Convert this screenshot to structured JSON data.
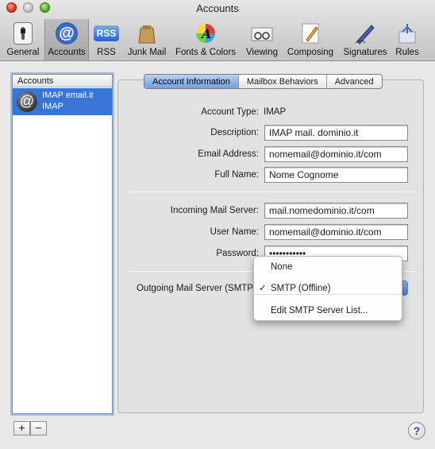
{
  "window": {
    "title": "Accounts"
  },
  "toolbar": [
    {
      "label": "General",
      "icon": "switch-icon"
    },
    {
      "label": "Accounts",
      "icon": "at-icon"
    },
    {
      "label": "RSS",
      "icon": "rss-icon"
    },
    {
      "label": "Junk Mail",
      "icon": "junk-bag-icon"
    },
    {
      "label": "Fonts & Colors",
      "icon": "font-color-icon"
    },
    {
      "label": "Viewing",
      "icon": "glasses-icon"
    },
    {
      "label": "Composing",
      "icon": "pencil-paper-icon"
    },
    {
      "label": "Signatures",
      "icon": "pen-icon"
    },
    {
      "label": "Rules",
      "icon": "rules-icon"
    }
  ],
  "sidebar": {
    "header": "Accounts",
    "items": [
      {
        "name": "IMAP email.it",
        "type": "IMAP"
      }
    ],
    "add_label": "+",
    "remove_label": "−"
  },
  "tabs": [
    "Account Information",
    "Mailbox Behaviors",
    "Advanced"
  ],
  "form": {
    "account_type_label": "Account Type:",
    "account_type_value": "IMAP",
    "description_label": "Description:",
    "description_value": "IMAP mail. dominio.it",
    "email_label": "Email Address:",
    "email_value": "nomemail@dominio.it/com",
    "fullname_label": "Full Name:",
    "fullname_value": "Nome Cognome",
    "incoming_label": "Incoming Mail Server:",
    "incoming_value": "mail.nomedominio.it/com",
    "username_label": "User Name:",
    "username_value": "nomemail@dominio.it/com",
    "password_label": "Password:",
    "password_value": "•••••••••••",
    "outgoing_label": "Outgoing Mail Server (SMTP):"
  },
  "smtp_menu": {
    "items": [
      {
        "label": "None",
        "checked": false
      },
      {
        "label": "SMTP (Offline)",
        "checked": true
      },
      {
        "label": "Edit SMTP Server List...",
        "checked": false
      }
    ],
    "check_mark": "✓"
  },
  "help_label": "?",
  "colors": {
    "selection": "#3875d7",
    "accent": "#6f9fe2"
  }
}
